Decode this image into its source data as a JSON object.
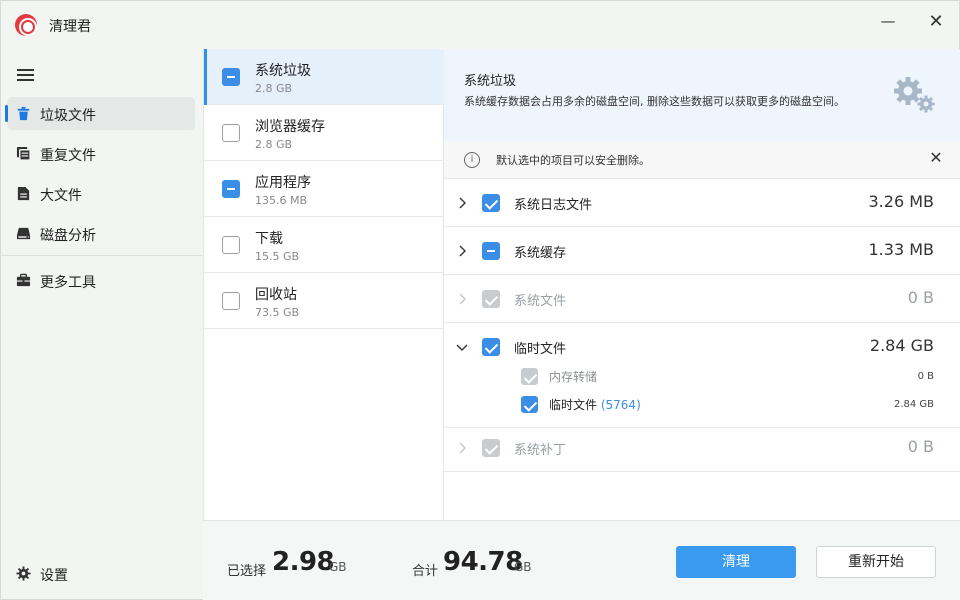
{
  "app": {
    "title": "清理君"
  },
  "window_controls": {
    "minimize": "—",
    "close": "✕"
  },
  "sidebar": {
    "items": [
      {
        "label": "垃圾文件",
        "icon": "trash-icon",
        "active": true
      },
      {
        "label": "重复文件",
        "icon": "duplicate-files-icon",
        "active": false
      },
      {
        "label": "大文件",
        "icon": "large-file-icon",
        "active": false
      },
      {
        "label": "磁盘分析",
        "icon": "disk-icon",
        "active": false
      },
      {
        "label": "更多工具",
        "icon": "toolbox-icon",
        "active": false
      }
    ],
    "settings": {
      "label": "设置",
      "icon": "gear-icon"
    }
  },
  "categories": [
    {
      "name": "系统垃圾",
      "size": "2.8 GB",
      "state": "partial",
      "active": true
    },
    {
      "name": "浏览器缓存",
      "size": "2.8 GB",
      "state": "unchecked",
      "active": false
    },
    {
      "name": "应用程序",
      "size": "135.6 MB",
      "state": "partial",
      "active": false
    },
    {
      "name": "下载",
      "size": "15.5 GB",
      "state": "unchecked",
      "active": false
    },
    {
      "name": "回收站",
      "size": "73.5 GB",
      "state": "unchecked",
      "active": false
    }
  ],
  "detail": {
    "title": "系统垃圾",
    "description": "系统缓存数据会占用多余的磁盘空间, 删除这些数据可以获取更多的磁盘空间。",
    "info": "默认选中的项目可以安全删除。",
    "rows": [
      {
        "name": "系统日志文件",
        "size": "3.26 MB",
        "state": "checked",
        "expanded": false,
        "disabled": false
      },
      {
        "name": "系统缓存",
        "size": "1.33 MB",
        "state": "partial",
        "expanded": false,
        "disabled": false
      },
      {
        "name": "系统文件",
        "size": "0 B",
        "state": "disabled",
        "expanded": false,
        "disabled": true
      },
      {
        "name": "临时文件",
        "size": "2.84 GB",
        "state": "checked",
        "expanded": true,
        "disabled": false,
        "children": [
          {
            "name": "内存转储",
            "count": "",
            "size": "0 B",
            "state": "disabled"
          },
          {
            "name": "临时文件",
            "count": "(5764)",
            "size": "2.84 GB",
            "state": "checked"
          }
        ]
      },
      {
        "name": "系统补丁",
        "size": "0 B",
        "state": "disabled",
        "expanded": false,
        "disabled": true
      }
    ]
  },
  "footer": {
    "selected_label": "已选择",
    "selected_value": "2.98",
    "selected_unit": "GB",
    "total_label": "合计",
    "total_value": "94.78",
    "total_unit": "GB",
    "clean_button": "清理",
    "restart_button": "重新开始"
  }
}
